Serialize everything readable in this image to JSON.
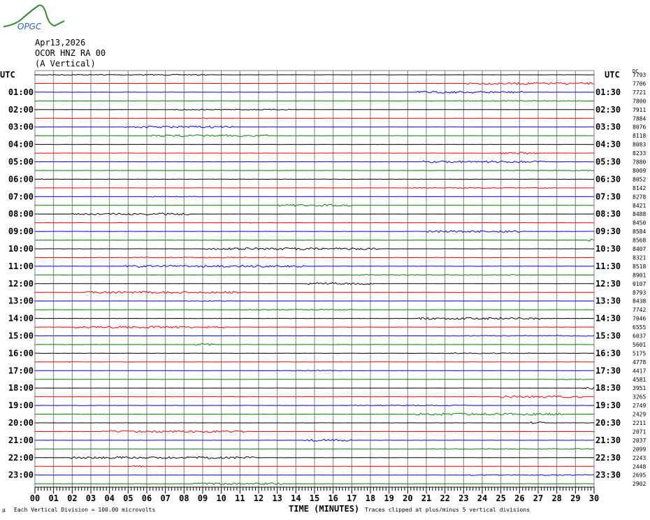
{
  "header": {
    "logo_text": "OPGC",
    "date": "Apr13,2026",
    "station": "OCOR HNZ RA 00",
    "component": "(A Vertical)"
  },
  "colors": {
    "trace_cycle": [
      "#000000",
      "#ff0000",
      "#0000ff",
      "#008000"
    ],
    "grid": "#808080"
  },
  "chart_data": {
    "type": "line",
    "title": "OCOR HNZ RA 00 helicorder",
    "left_axis_title": "UTC",
    "right_axis_title": "UTC",
    "dc_label": "DC",
    "left_labels": [
      "01:00",
      "02:00",
      "03:00",
      "04:00",
      "05:00",
      "06:00",
      "07:00",
      "08:00",
      "09:00",
      "10:00",
      "11:00",
      "12:00",
      "13:00",
      "14:00",
      "15:00",
      "16:00",
      "17:00",
      "18:00",
      "19:00",
      "20:00",
      "21:00",
      "22:00",
      "23:00"
    ],
    "right_labels": [
      "01:30",
      "02:30",
      "03:30",
      "04:30",
      "05:30",
      "06:30",
      "07:30",
      "08:30",
      "09:30",
      "10:30",
      "11:30",
      "12:30",
      "13:30",
      "14:30",
      "15:30",
      "16:30",
      "17:30",
      "18:30",
      "19:30",
      "20:30",
      "21:30",
      "22:30",
      "23:30"
    ],
    "dc_offsets": [
      7793,
      7706,
      7721,
      7800,
      7911,
      7884,
      8076,
      8118,
      8083,
      8233,
      7880,
      8009,
      8052,
      8142,
      8278,
      8421,
      8488,
      8450,
      8584,
      8568,
      8407,
      8321,
      8518,
      8901,
      9107,
      8793,
      8438,
      7742,
      7046,
      6555,
      6037,
      5601,
      5175,
      4778,
      4417,
      4581,
      3951,
      3265,
      2749,
      2429,
      2211,
      2071,
      2037,
      2099,
      2243,
      2448,
      2695,
      2902
    ],
    "x_ticks": [
      "00",
      "01",
      "02",
      "03",
      "04",
      "05",
      "06",
      "07",
      "08",
      "09",
      "10",
      "11",
      "12",
      "13",
      "14",
      "15",
      "16",
      "17",
      "18",
      "19",
      "20",
      "21",
      "22",
      "23",
      "24",
      "25",
      "26",
      "27",
      "28",
      "29",
      "30"
    ],
    "xlabel": "TIME (MINUTES)",
    "xlim": [
      0,
      30
    ],
    "trace_count": 48,
    "trace_minutes": 30
  },
  "footer": {
    "corner_mark": "µ",
    "scale_note": "Each Vertical Division =  100.00 microvolts",
    "clip_note": "Traces clipped at plus/minus 5 vertical divisions"
  }
}
